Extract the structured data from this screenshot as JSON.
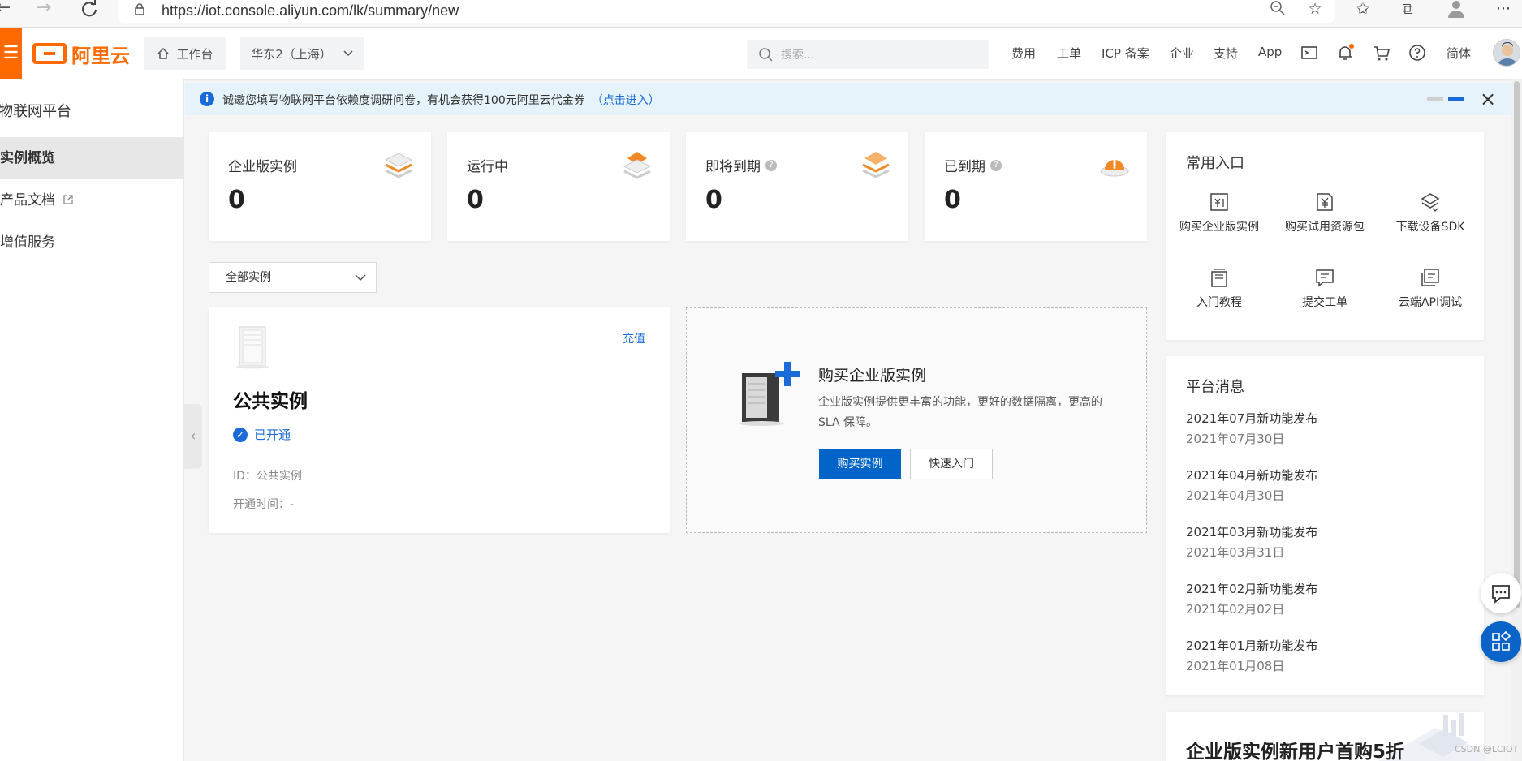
{
  "browser": {
    "url": "https://iot.console.aliyun.com/lk/summary/new"
  },
  "header": {
    "menu_label": "☰",
    "logo_text": "阿里云",
    "workbench_label": "工作台",
    "region_label": "华东2（上海）",
    "search_placeholder": "搜索...",
    "links": [
      "费用",
      "工单",
      "ICP 备案",
      "企业",
      "支持",
      "App"
    ],
    "lang_label": "简体"
  },
  "sidebar": {
    "title": "物联网平台",
    "items": [
      {
        "label": "实例概览",
        "active": true
      },
      {
        "label": "产品文档",
        "external": true
      },
      {
        "label": "增值服务",
        "active": false
      }
    ]
  },
  "notice": {
    "text": "诚邀您填写物联网平台依赖度调研问卷，有机会获得100元阿里云代金券",
    "link": "（点击进入）"
  },
  "stats": [
    {
      "label": "企业版实例",
      "value": "0",
      "help": false,
      "icon": "enterprise-stack-icon"
    },
    {
      "label": "运行中",
      "value": "0",
      "help": false,
      "icon": "running-stack-icon"
    },
    {
      "label": "即将到期",
      "value": "0",
      "help": true,
      "icon": "expiring-stack-icon"
    },
    {
      "label": "已到期",
      "value": "0",
      "help": true,
      "icon": "expired-alert-icon"
    }
  ],
  "filter": {
    "selected": "全部实例"
  },
  "public_instance": {
    "recharge_label": "充值",
    "title": "公共实例",
    "status": "已开通",
    "id_line": "ID：公共实例",
    "open_time_line": "开通时间：-"
  },
  "buy_card": {
    "title": "购买企业版实例",
    "desc": "企业版实例提供更丰富的功能，更好的数据隔离，更高的 SLA 保障。",
    "primary_label": "购买实例",
    "secondary_label": "快速入门"
  },
  "common_entries": {
    "title": "常用入口",
    "items": [
      {
        "label": "购买企业版实例",
        "icon": "buy-enterprise-icon"
      },
      {
        "label": "购买试用资源包",
        "icon": "buy-trial-icon"
      },
      {
        "label": "下载设备SDK",
        "icon": "sdk-download-icon"
      },
      {
        "label": "入门教程",
        "icon": "tutorial-icon"
      },
      {
        "label": "提交工单",
        "icon": "ticket-icon"
      },
      {
        "label": "云端API调试",
        "icon": "api-debug-icon"
      }
    ]
  },
  "platform_news": {
    "title": "平台消息",
    "items": [
      {
        "title": "2021年07月新功能发布",
        "date": "2021年07月30日"
      },
      {
        "title": "2021年04月新功能发布",
        "date": "2021年04月30日"
      },
      {
        "title": "2021年03月新功能发布",
        "date": "2021年03月31日"
      },
      {
        "title": "2021年02月新功能发布",
        "date": "2021年02月02日"
      },
      {
        "title": "2021年01月新功能发布",
        "date": "2021年01月08日"
      }
    ]
  },
  "promo": {
    "title": "企业版实例新用户首购5折"
  },
  "watermark": "CSDN @LCIOT",
  "colors": {
    "brand_orange": "#ff6a00",
    "primary_blue": "#0064c8",
    "link_blue": "#1a6bd8"
  }
}
